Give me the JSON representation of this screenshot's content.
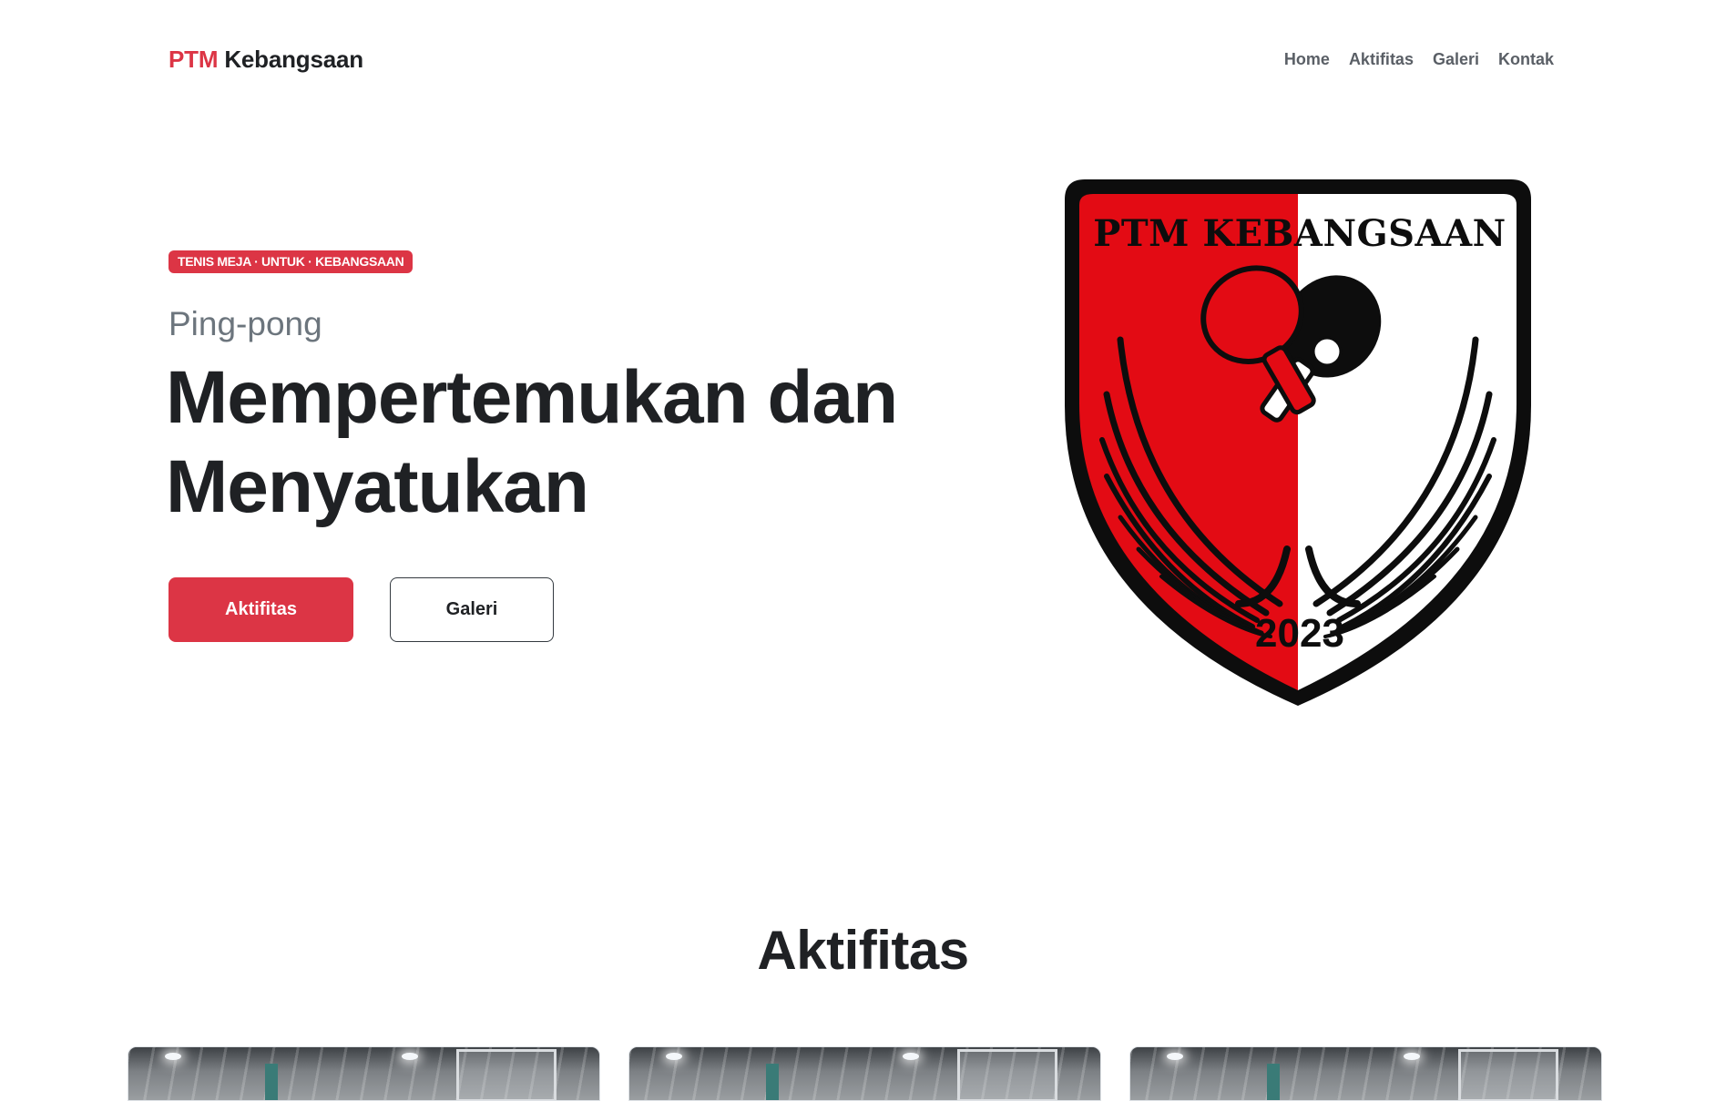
{
  "brand": {
    "accent": "PTM",
    "name": "Kebangsaan"
  },
  "nav": {
    "items": [
      "Home",
      "Aktifitas",
      "Galeri",
      "Kontak"
    ]
  },
  "hero": {
    "badge": "TENIS MEJA · UNTUK · KEBANGSAAN",
    "subtitle": "Ping-pong",
    "title_line1": "Mempertemukan dan",
    "title_line2": "Menyatukan",
    "primary_button": "Aktifitas",
    "secondary_button": "Galeri"
  },
  "logo": {
    "title": "PTM KEBANGSAAN",
    "year": "2023",
    "icon": "ping-pong-paddles-icon"
  },
  "activities": {
    "title": "Aktifitas",
    "cards": [
      {
        "image": "activity-photo"
      },
      {
        "image": "activity-photo"
      },
      {
        "image": "activity-photo"
      }
    ]
  },
  "colors": {
    "accent": "#dc3545",
    "text": "#1f2124",
    "muted": "#6c757d",
    "nav": "#5a5f66",
    "logo_red": "#e30b14",
    "logo_black": "#0d0d0d"
  }
}
